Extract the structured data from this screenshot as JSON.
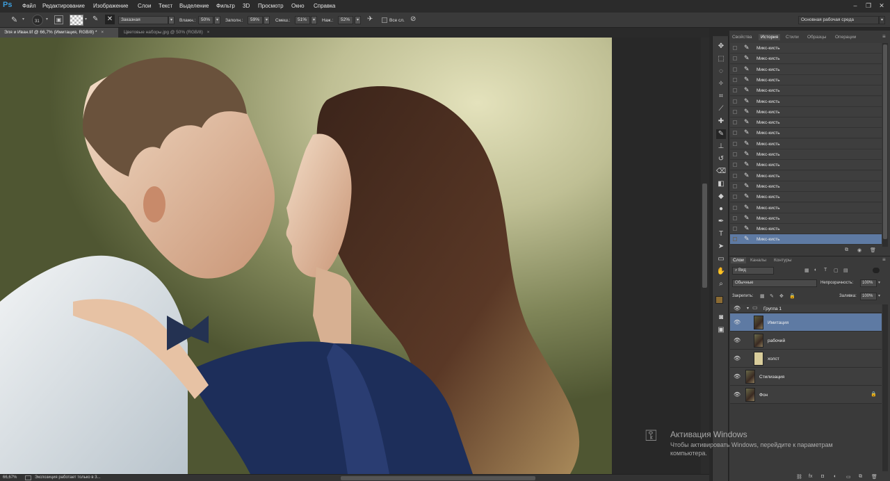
{
  "app": {
    "logo": "Ps",
    "menu": [
      "Файл",
      "Редактирование",
      "Изображение",
      "Слои",
      "Текст",
      "Выделение",
      "Фильтр",
      "3D",
      "Просмотр",
      "Окно",
      "Справка"
    ]
  },
  "options": {
    "brush_size": "31",
    "mode": "Заказная",
    "wet_label": "Влажн.:",
    "wet_value": "50%",
    "load_label": "Заполн.:",
    "load_value": "59%",
    "mix_label": "Смеш.:",
    "mix_value": "51%",
    "flow_label": "Наж.:",
    "flow_value": "52%",
    "sample_all_label": "Все сл.",
    "workspace": "Основная рабочая среда"
  },
  "doc_tabs": [
    {
      "label": "Эля и Иван.tif @ 66,7% (Имитация, RGB/8) *",
      "active": true,
      "close": "×"
    },
    {
      "label": "Цветовые наборы.jpg @ 50% (RGB/8)",
      "active": false,
      "close": "×"
    }
  ],
  "status": {
    "zoom": "66,67%",
    "message": "Экспозиция работает только в 3..."
  },
  "panels": {
    "tabs": [
      "Свойства",
      "История",
      "Стили",
      "Образцы",
      "Операции"
    ],
    "active_tab": "История",
    "history": [
      "Микс-кисть",
      "Микс-кисть",
      "Микс-кисть",
      "Микс-кисть",
      "Микс-кисть",
      "Микс-кисть",
      "Микс-кисть",
      "Микс-кисть",
      "Микс-кисть",
      "Микс-кисть",
      "Микс-кисть",
      "Микс-кисть",
      "Микс-кисть",
      "Микс-кисть",
      "Микс-кисть",
      "Микс-кисть",
      "Микс-кисть",
      "Микс-кисть",
      "Микс-кисть"
    ]
  },
  "layers": {
    "tabs": [
      "Слои",
      "Каналы",
      "Контуры"
    ],
    "filter": "Вид",
    "blend_mode": "Обычные",
    "opacity_label": "Непрозрачность:",
    "opacity_value": "100%",
    "lock_label": "Закрепить:",
    "fill_label": "Заливка:",
    "fill_value": "100%",
    "group": "Группа 1",
    "items": [
      {
        "name": "Имитация",
        "selected": true
      },
      {
        "name": "рабочий",
        "selected": false
      },
      {
        "name": "холст",
        "selected": false
      },
      {
        "name": "Стилизация",
        "selected": false
      },
      {
        "name": "Фон",
        "selected": false
      }
    ]
  },
  "watermark": {
    "title": "Активация Windows",
    "line1": "Чтобы активировать Windows, перейдите к параметрам",
    "line2": "компьютера."
  },
  "colors": {
    "accent": "#5e7aa3",
    "foreground": "#8b6b33",
    "background": "#e8e2c8"
  }
}
